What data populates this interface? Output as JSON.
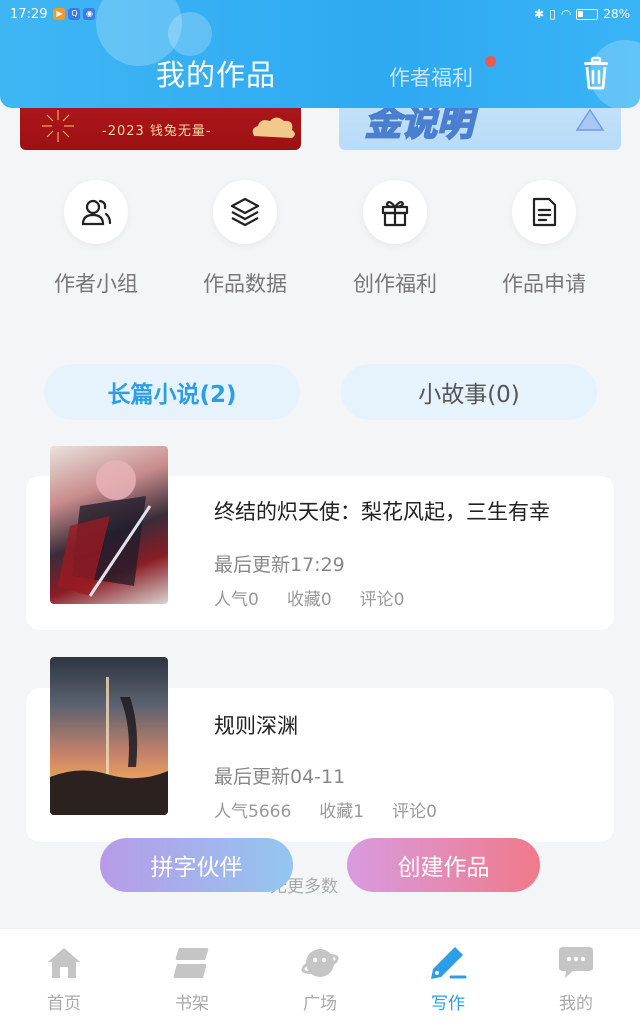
{
  "status_bar": {
    "time": "17:29",
    "battery": "28%"
  },
  "header": {
    "title": "我的作品",
    "welfare_tab": "作者福利"
  },
  "banners": {
    "left_text": "-2023 钱兔无量-",
    "right_text": "金说明"
  },
  "quick_actions": [
    {
      "label": "作者小组",
      "icon": "author-group-icon"
    },
    {
      "label": "作品数据",
      "icon": "layers-icon"
    },
    {
      "label": "创作福利",
      "icon": "gift-icon"
    },
    {
      "label": "作品申请",
      "icon": "document-icon"
    }
  ],
  "tabs": [
    {
      "label": "长篇小说(2)",
      "active": true
    },
    {
      "label": "小故事(0)",
      "active": false
    }
  ],
  "works": [
    {
      "title": "终结的炽天使：梨花风起，三生有幸",
      "updated": "最后更新17:29",
      "popularity": "人气0",
      "favorites": "收藏0",
      "comments": "评论0"
    },
    {
      "title": "规则深渊",
      "updated": "最后更新04-11",
      "popularity": "人气5666",
      "favorites": "收藏1",
      "comments": "评论0"
    }
  ],
  "no_more_text": "无更多数",
  "buttons": {
    "partner": "拼字伙伴",
    "create": "创建作品"
  },
  "bottom_nav": [
    {
      "label": "首页",
      "icon": "home-icon",
      "active": false
    },
    {
      "label": "书架",
      "icon": "bookshelf-icon",
      "active": false
    },
    {
      "label": "广场",
      "icon": "planet-icon",
      "active": false
    },
    {
      "label": "写作",
      "icon": "pen-icon",
      "active": true
    },
    {
      "label": "我的",
      "icon": "chat-bubble-icon",
      "active": false
    }
  ],
  "colors": {
    "header": "#2ea9f2",
    "accent": "#2c9ee8",
    "badge": "#ec5a4b"
  }
}
